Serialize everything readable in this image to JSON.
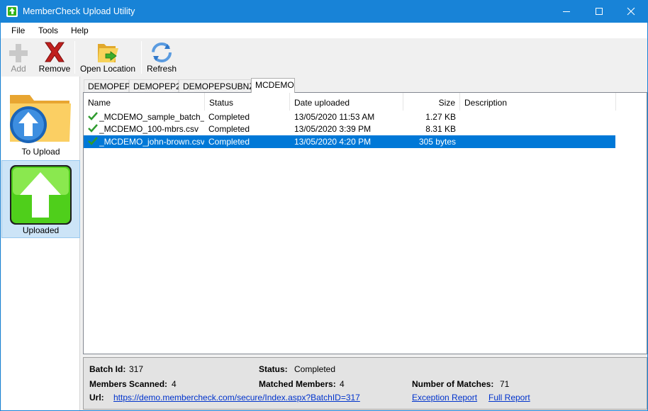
{
  "window": {
    "title": "MemberCheck Upload Utility",
    "accent_color": "#1883d7"
  },
  "menu": {
    "items": [
      "File",
      "Tools",
      "Help"
    ]
  },
  "toolbar": {
    "add_label": "Add",
    "remove_label": "Remove",
    "open_location_label": "Open Location",
    "refresh_label": "Refresh"
  },
  "sidebar": {
    "to_upload_label": "To Upload",
    "uploaded_label": "Uploaded"
  },
  "tabs": [
    "DEMOPEP",
    "DEMOPEP2",
    "DEMOPEPSUBNZ",
    "MCDEMO"
  ],
  "list": {
    "columns": [
      "Name",
      "Status",
      "Date uploaded",
      "Size",
      "Description"
    ],
    "rows": [
      {
        "name": "_MCDEMO_sample_batch_f...",
        "status": "Completed",
        "date": "13/05/2020 11:53 AM",
        "size": "1.27 KB",
        "description": ""
      },
      {
        "name": "_MCDEMO_100-mbrs.csv",
        "status": "Completed",
        "date": "13/05/2020 3:39 PM",
        "size": "8.31 KB",
        "description": ""
      },
      {
        "name": "_MCDEMO_john-brown.csv",
        "status": "Completed",
        "date": "13/05/2020 4:20 PM",
        "size": "305 bytes",
        "description": ""
      }
    ]
  },
  "details": {
    "batch_id_label": "Batch Id:",
    "batch_id": "317",
    "status_label": "Status:",
    "status": "Completed",
    "members_scanned_label": "Members Scanned:",
    "members_scanned": "4",
    "matched_members_label": "Matched Members:",
    "matched_members": "4",
    "number_of_matches_label": "Number of Matches:",
    "number_of_matches": "71",
    "url_label": "Url:",
    "url": "https://demo.membercheck.com/secure/Index.aspx?BatchID=317",
    "exception_report": "Exception Report",
    "full_report": "Full Report"
  }
}
